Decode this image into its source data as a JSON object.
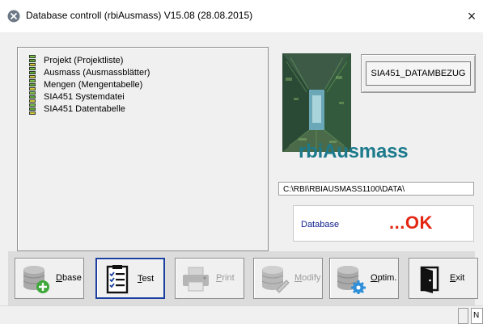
{
  "window": {
    "title": "Database controll (rbiAusmass) V15.08 (28.08.2015)",
    "close_glyph": "×"
  },
  "list_items": [
    {
      "label": "Projekt (Projektliste)",
      "icon": "db-status-icon"
    },
    {
      "label": "Ausmass (Ausmassblätter)",
      "icon": "db-status-icon"
    },
    {
      "label": "Mengen (Mengentabelle)",
      "icon": "db-status-icon"
    },
    {
      "label": "SIA451 Systemdatei",
      "icon": "db-status-icon"
    },
    {
      "label": "SIA451 Datentabelle",
      "icon": "db-status-icon"
    }
  ],
  "brand": {
    "text": "rbiAusmass",
    "color": "#1c7a8c"
  },
  "datambezug_button": {
    "label": "SIA451_DATAMBEZUG"
  },
  "path_field": {
    "value": "C:\\RBI\\RBIAUSMASS1100\\DATA\\"
  },
  "status": {
    "label": "Database",
    "value": "...OK",
    "value_color": "#e32612",
    "label_color": "#0f1f8f"
  },
  "toolbar": {
    "dbase": {
      "pre": "",
      "accel": "D",
      "post": "base",
      "icon": "database-add-icon"
    },
    "test": {
      "pre": "",
      "accel": "T",
      "post": "est",
      "icon": "checklist-icon"
    },
    "print": {
      "pre": "",
      "accel": "P",
      "post": "rint",
      "icon": "printer-icon"
    },
    "modify": {
      "pre": "",
      "accel": "M",
      "post": "odify",
      "icon": "database-modify-icon"
    },
    "optim": {
      "pre": "",
      "accel": "O",
      "post": "ptim.",
      "icon": "database-settings-icon"
    },
    "exit": {
      "pre": "",
      "accel": "E",
      "post": "xit",
      "icon": "exit-door-icon"
    }
  },
  "statusbar": {
    "cell_text": "N"
  }
}
